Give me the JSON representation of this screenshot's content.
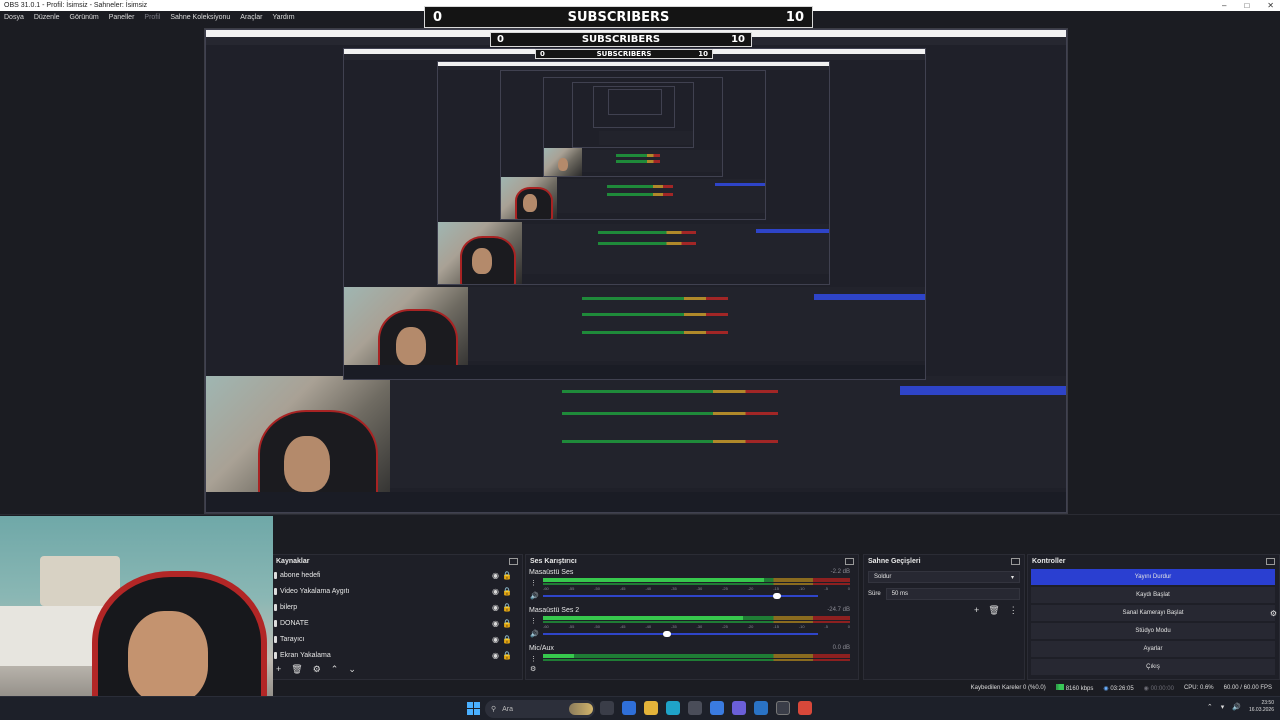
{
  "window": {
    "title": "OBS 31.0.1 - Profil: İsimsiz - Sahneler: İsimsiz"
  },
  "menu": [
    "Dosya",
    "Düzenle",
    "Görünüm",
    "Paneller",
    "Profil",
    "Sahne Koleksiyonu",
    "Araçlar",
    "Yardım"
  ],
  "overlay": {
    "label": "SUBSCRIBERS",
    "current": "0",
    "goal": "10"
  },
  "sources": {
    "title": "Kaynaklar",
    "items": [
      "abone hedefi",
      "Video Yakalama Aygıtı",
      "bilerp",
      "DONATE",
      "Tarayıcı",
      "Ekran Yakalama"
    ]
  },
  "mixer": {
    "title": "Ses Karıştırıcı",
    "channels": [
      {
        "name": "Masaüstü Ses",
        "db": "-2.2 dB",
        "level": 0.72,
        "volume": 0.85
      },
      {
        "name": "Masaüstü Ses 2",
        "db": "-24.7 dB",
        "level": 0.65,
        "volume": 0.45
      },
      {
        "name": "Mic/Aux",
        "db": "0.0 dB",
        "level": 0.1,
        "volume": 1.0
      }
    ],
    "ticks": [
      "-60",
      "-55",
      "-50",
      "-45",
      "-40",
      "-35",
      "-30",
      "-25",
      "-20",
      "-15",
      "-10",
      "-5",
      "0"
    ]
  },
  "transitions": {
    "title": "Sahne Geçişleri",
    "selected": "Soldur",
    "duration_label": "Süre",
    "duration_value": "50 ms"
  },
  "controls": {
    "title": "Kontroller",
    "buttons": [
      "Yayını Durdur",
      "Kaydı Başlat",
      "Sanal Kamerayı Başlat",
      "Stüdyo Modu",
      "Ayarlar",
      "Çıkış"
    ]
  },
  "status": {
    "dropped": "Kaybedilen Kareler 0 (%0.0)",
    "bitrate": "8160 kbps",
    "stream_time": "03:26:05",
    "rec_time": "00:00:00",
    "cpu": "CPU: 0.6%",
    "fps": "60.00 / 60.00 FPS"
  },
  "taskbar": {
    "search_placeholder": "Ara",
    "time": "23:50",
    "date": "16.03.2026"
  },
  "colors": {
    "accent": "#2a3fd1",
    "live": "#2fa24a",
    "bg": "#1b1c22"
  }
}
